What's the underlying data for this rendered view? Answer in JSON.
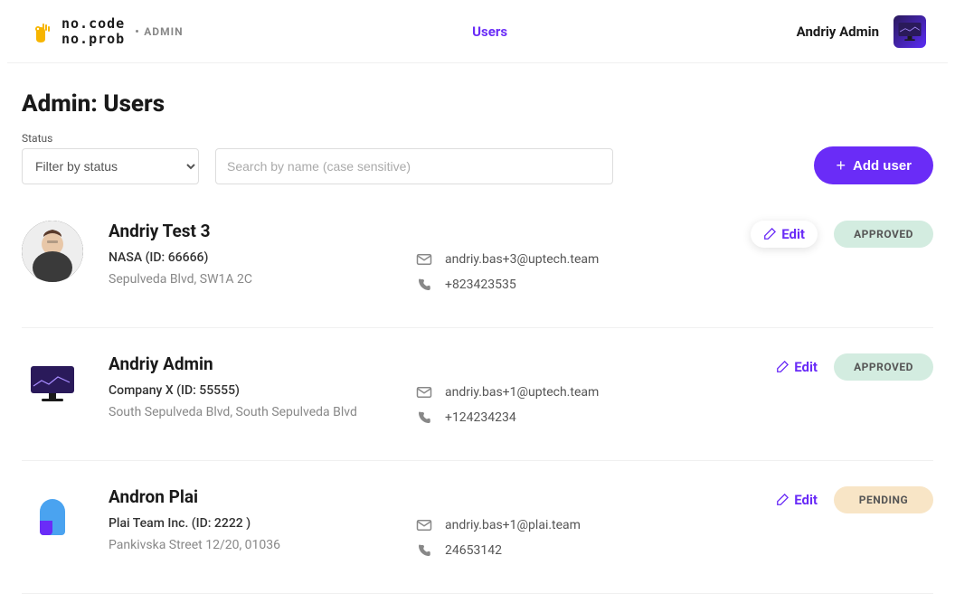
{
  "header": {
    "logo_line1": "no.code",
    "logo_line2": "no.prob",
    "logo_suffix": "ADMIN",
    "nav_label": "Users",
    "user_name": "Andriy Admin"
  },
  "page": {
    "title": "Admin: Users"
  },
  "filters": {
    "status_label": "Status",
    "status_placeholder": "Filter by status",
    "search_placeholder": "Search by name (case sensitive)"
  },
  "actions": {
    "add_user_label": "Add user",
    "edit_label": "Edit"
  },
  "status_types": {
    "approved": "APPROVED",
    "pending": "PENDING"
  },
  "users": [
    {
      "name": "Andriy Test 3",
      "company": "NASA (ID: 66666)",
      "address": "Sepulveda Blvd, SW1A 2C",
      "email": "andriy.bas+3@uptech.team",
      "phone": "+823423535",
      "status": "APPROVED",
      "status_class": "approved",
      "avatar_type": "person",
      "edit_highlighted": true
    },
    {
      "name": "Andriy Admin",
      "company": "Company X (ID: 55555)",
      "address": "South Sepulveda Blvd, South Sepulveda Blvd",
      "email": "andriy.bas+1@uptech.team",
      "phone": "+124234234",
      "status": "APPROVED",
      "status_class": "approved",
      "avatar_type": "monitor",
      "edit_highlighted": false
    },
    {
      "name": "Andron Plai",
      "company": "Plai Team Inc. (ID: 2222 )",
      "address": "Pankivska Street 12/20, 01036",
      "email": "andriy.bas+1@plai.team",
      "phone": "24653142",
      "status": "PENDING",
      "status_class": "pending",
      "avatar_type": "letter",
      "edit_highlighted": false
    }
  ]
}
